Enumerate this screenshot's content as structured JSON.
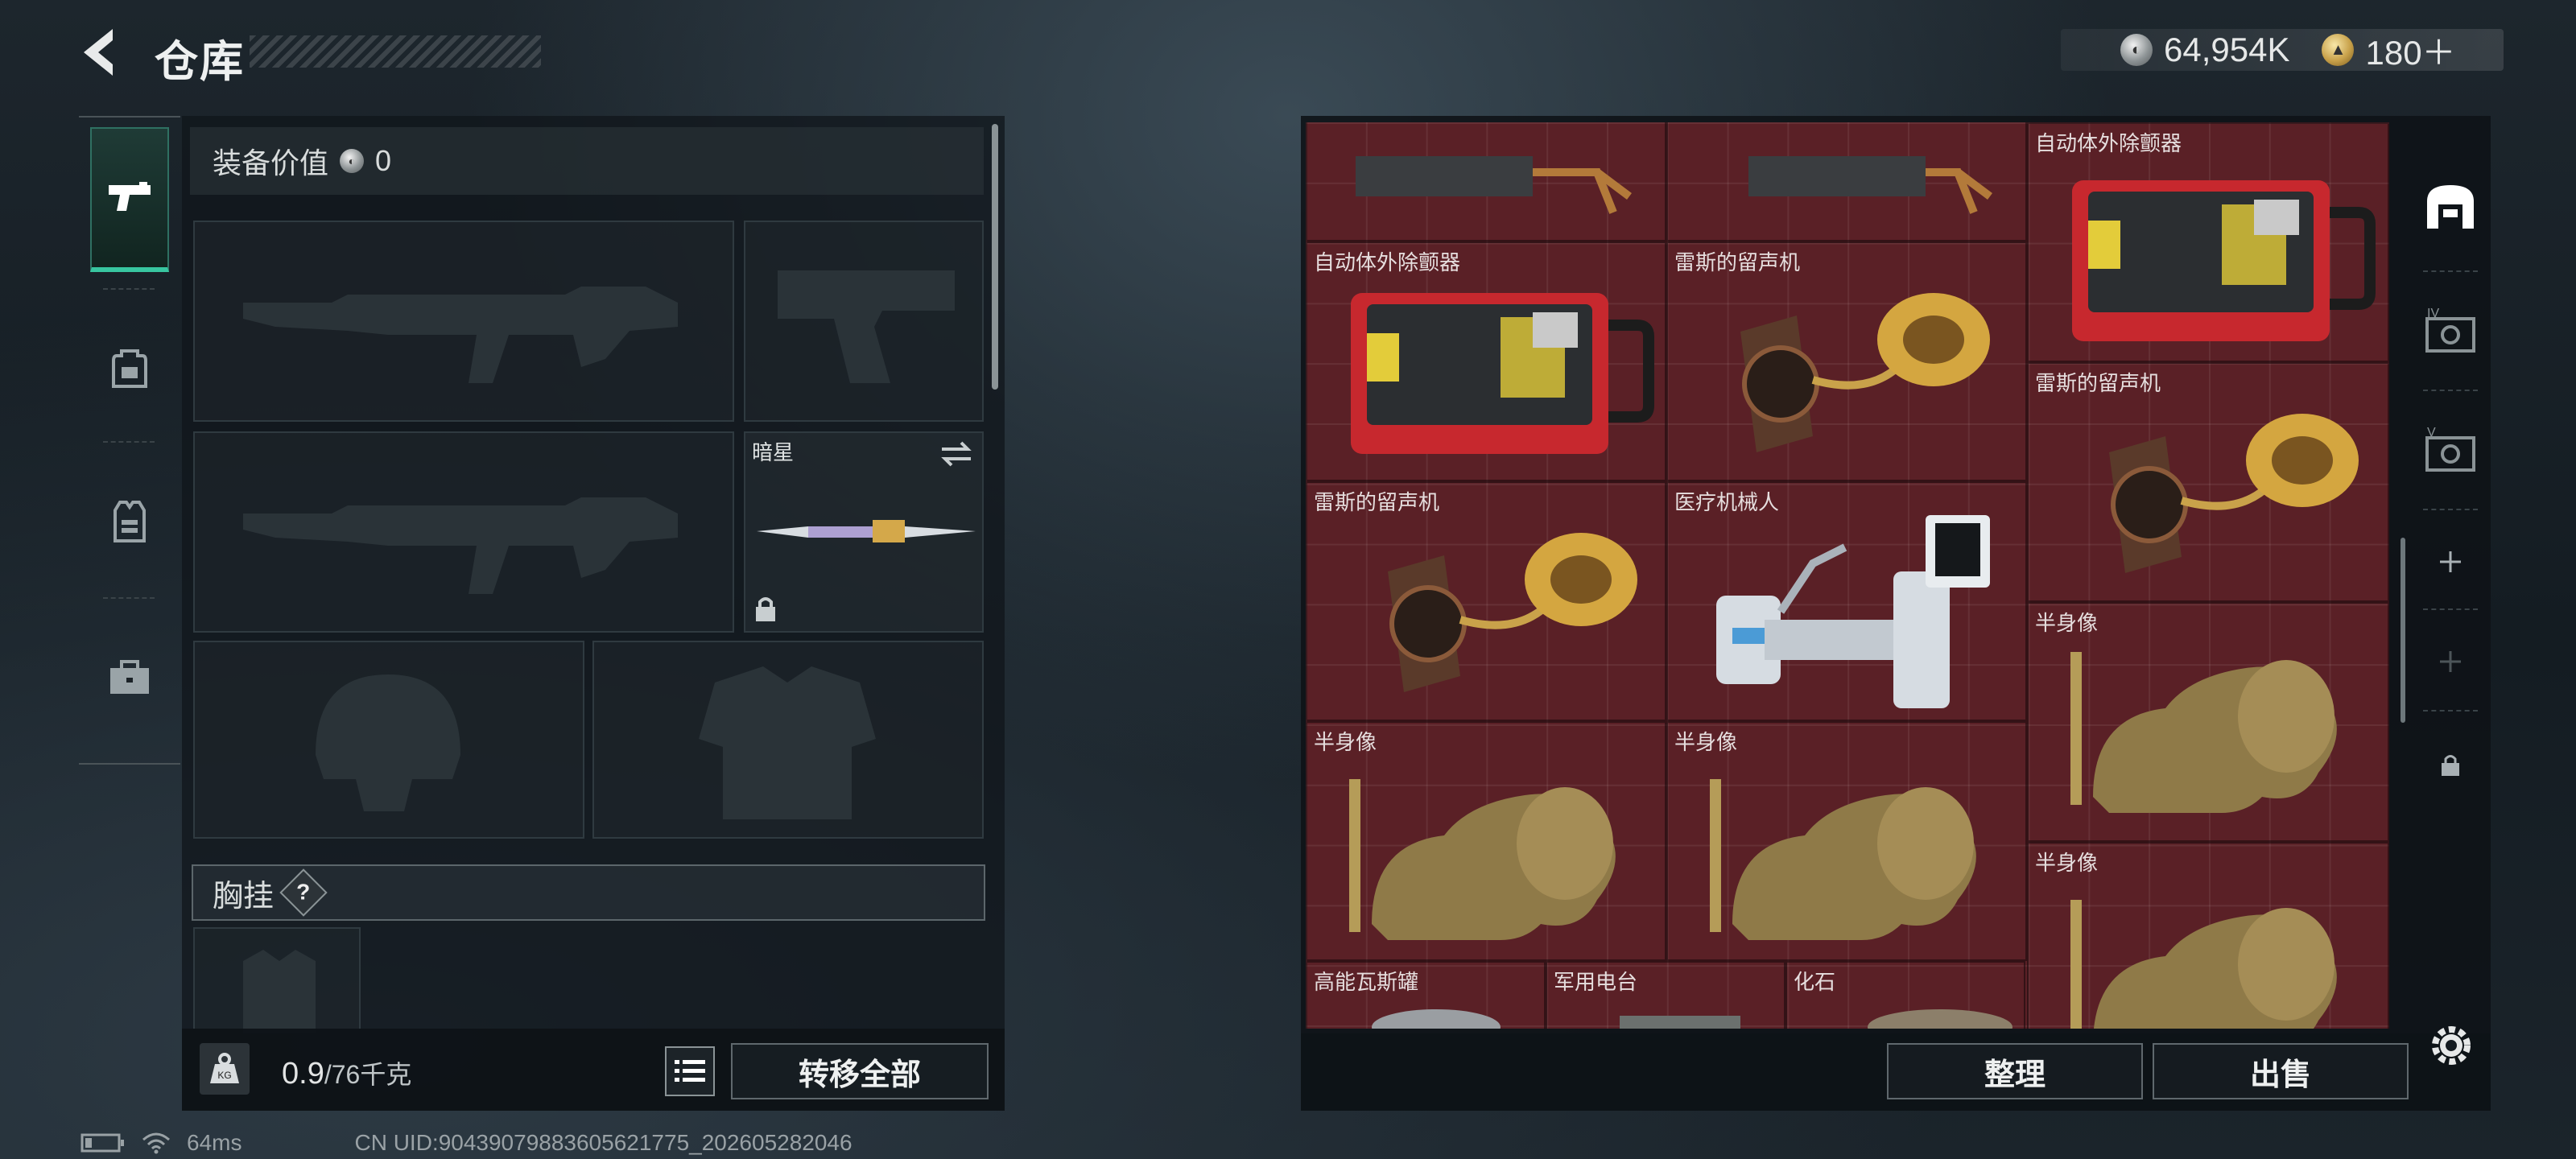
{
  "header": {
    "title": "仓库",
    "currency": [
      {
        "icon": "silver-coin-icon",
        "value": "64,954K"
      },
      {
        "icon": "gold-triangle-coin-icon",
        "value": "180＋"
      }
    ]
  },
  "left": {
    "categories": [
      {
        "name": "pistol-icon",
        "active": true
      },
      {
        "name": "backpack-icon",
        "active": false
      },
      {
        "name": "vest-icon",
        "active": false
      },
      {
        "name": "toolbox-icon",
        "active": false
      }
    ],
    "equip_value_label": "装备价值",
    "equip_value": "0",
    "melee_slot_label": "暗星",
    "chest_rig_label": "胸挂",
    "chest_rig_help": "?",
    "weight_value": "0.9",
    "weight_max": "/76千克",
    "weight_icon_label": "KG",
    "transfer_all_label": "转移全部"
  },
  "right": {
    "items": [
      {
        "label": ""
      },
      {
        "label": ""
      },
      {
        "label": "自动体外除颤器"
      },
      {
        "label": "自动体外除颤器"
      },
      {
        "label": "雷斯的留声机"
      },
      {
        "label": "雷斯的留声机"
      },
      {
        "label": "雷斯的留声机"
      },
      {
        "label": "医疗机械人"
      },
      {
        "label": "半身像"
      },
      {
        "label": "半身像"
      },
      {
        "label": "半身像"
      },
      {
        "label": "半身像"
      },
      {
        "label": "高能瓦斯罐"
      },
      {
        "label": "军用电台"
      },
      {
        "label": "化石"
      }
    ],
    "sort_label": "整理",
    "sell_label": "出售"
  },
  "status": {
    "ping": "64ms",
    "uid": "CN UID:9043907988360562177​5_202605282046"
  },
  "colors": {
    "accent": "#38c6a0",
    "grid_bg": "#5a2026",
    "panel_bg": "#10161b"
  }
}
